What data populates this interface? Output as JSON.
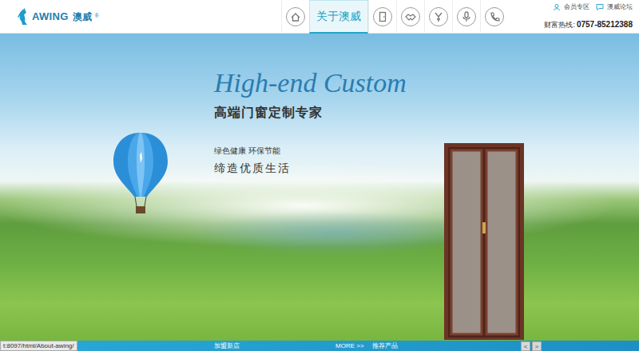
{
  "header": {
    "logo": {
      "brand": "AWING",
      "cn": "澳威",
      "reg": "®"
    },
    "nav": [
      {
        "kind": "icon",
        "selected": false
      },
      {
        "kind": "text",
        "label": "关于澳威",
        "selected": true
      },
      {
        "kind": "icon",
        "selected": false
      },
      {
        "kind": "icon",
        "selected": false
      },
      {
        "kind": "icon",
        "selected": false
      },
      {
        "kind": "icon",
        "selected": false
      },
      {
        "kind": "icon",
        "selected": false
      }
    ],
    "links": [
      {
        "label": "会员专区"
      },
      {
        "label": "澳威论坛"
      }
    ],
    "hotline": {
      "label": "财富热线:",
      "number": "0757-85212388"
    }
  },
  "hero": {
    "title": "High-end Custom",
    "subtitle": "高端门窗定制专家",
    "slogan_small": "绿色健康 环保节能",
    "slogan": "缔造优质生活"
  },
  "bottom_bar": {
    "items": [
      "加盟新店",
      "MORE >>",
      "推荐产品"
    ],
    "arrows": [
      "<",
      ">"
    ]
  },
  "status_bar": {
    "text": "t:8097/html/About-awing/"
  }
}
